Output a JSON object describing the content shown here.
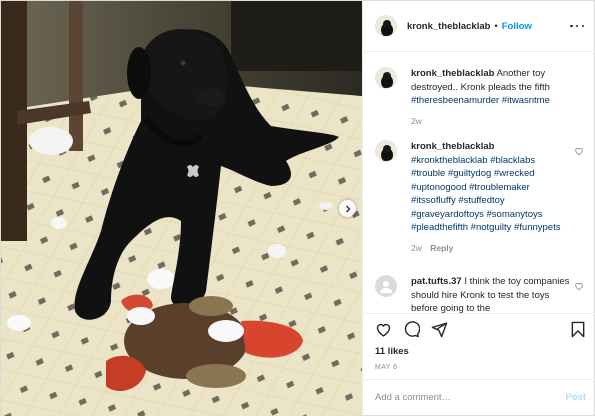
{
  "header": {
    "username": "kronk_theblacklab",
    "separator": "•",
    "follow_label": "Follow"
  },
  "caption": {
    "username": "kronk_theblacklab",
    "text": "Another toy destroyed.. Kronk pleads the fifth",
    "hashtags": "#theresbeenamurder #itwasntme",
    "time": "2w"
  },
  "comments": [
    {
      "username": "kronk_theblacklab",
      "text": "",
      "hashtags": "#kronktheblacklab #blacklabs #trouble #guiltydog #wrecked #uptonogood #troublemaker #itssofluffy #stuffedtoy #graveyardoftoys #somanytoys #pleadthefifth #notguilty #funnypets",
      "time": "2w",
      "reply_label": "Reply"
    },
    {
      "username": "pat.tufts.37",
      "text": "I think the toy companies should hire Kronk to test the toys before going to the"
    }
  ],
  "actions": {
    "likes": "11 likes",
    "date": "MAY 6"
  },
  "add_comment": {
    "placeholder": "Add a comment…",
    "post_label": "Post"
  },
  "colors": {
    "link": "#0095f6",
    "hashtag": "#00376b",
    "muted": "#8e8e8e",
    "post_disabled": "#b2dffc"
  },
  "icons": [
    "three-dots-icon",
    "heart-icon",
    "comment-icon",
    "share-icon",
    "bookmark-icon",
    "chevron-right-icon"
  ]
}
